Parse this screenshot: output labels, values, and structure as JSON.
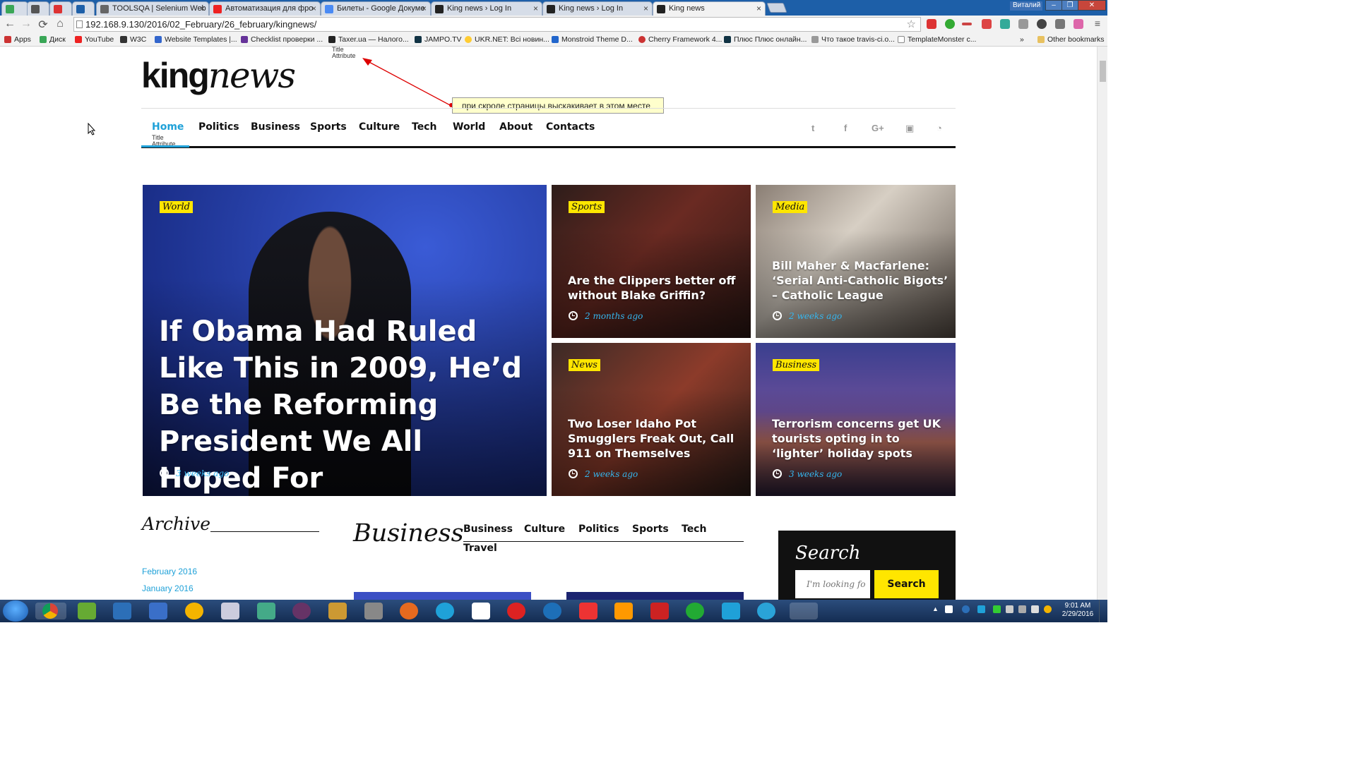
{
  "browser": {
    "tabs": [
      {
        "label": "",
        "active": false
      },
      {
        "label": "",
        "active": false
      },
      {
        "label": "",
        "active": false
      },
      {
        "label": "",
        "active": false
      },
      {
        "label": "TOOLSQA | Selenium Web",
        "active": false
      },
      {
        "label": "Автоматизация для фро",
        "active": false
      },
      {
        "label": "Билеты - Google Докуме",
        "active": false
      },
      {
        "label": "King news › Log In",
        "active": false
      },
      {
        "label": "King news › Log In",
        "active": false
      },
      {
        "label": "King news",
        "active": true
      }
    ],
    "user_name": "Виталий",
    "url": "192.168.9.130/2016/02_February/26_february/kingnews/",
    "bookmarks": [
      "Apps",
      "Диск",
      "YouTube",
      "W3C",
      "Website Templates |...",
      "Checklist проверки ...",
      "Taxer.ua — Налого...",
      "JAMPO.TV",
      "UKR.NET: Всі новин...",
      "Monstroid Theme D...",
      "Cherry Framework 4...",
      "Плюс Плюс онлайн...",
      "Что такое travis-ci.o...",
      "TemplateMonster c..."
    ],
    "other_bookmarks": "Other bookmarks",
    "badge_count": "2"
  },
  "site": {
    "logo_bold": "king",
    "logo_italic": "news",
    "tooltip_top": "Title Attribute",
    "annotation": "при скроле страницы выскакивает в этом месте",
    "nav": [
      "Home",
      "Politics",
      "Business",
      "Sports",
      "Culture",
      "Tech",
      "World",
      "About",
      "Contacts"
    ],
    "nav_tooltip": "Title Attribute",
    "social": [
      "twitter-icon",
      "facebook-icon",
      "google-plus-icon",
      "youtube-icon",
      "rss-icon"
    ]
  },
  "hero": {
    "main": {
      "tag": "World",
      "title": "If Obama Had Ruled Like This in 2009, He’d Be the Reforming President We All Hoped For",
      "time": "3 weeks ago"
    },
    "cards": [
      {
        "tag": "Sports",
        "title": "Are the Clippers better off without Blake Griffin?",
        "time": "2 months ago"
      },
      {
        "tag": "Media",
        "title": "Bill Maher & Macfarlene: ‘Serial Anti-Catholic Bigots’ – Catholic League",
        "time": "2 weeks ago"
      },
      {
        "tag": "News",
        "title": "Two Loser Idaho Pot Smugglers Freak Out, Call 911 on Themselves",
        "time": "2 weeks ago"
      },
      {
        "tag": "Business",
        "title": "Terrorism concerns get UK tourists opting in to ‘lighter’ holiday spots",
        "time": "3 weeks ago"
      }
    ]
  },
  "archive": {
    "title": "Archive",
    "links": [
      "February 2016",
      "January 2016"
    ]
  },
  "business": {
    "title": "Business",
    "tabs": [
      "Business",
      "Culture",
      "Politics",
      "Sports",
      "Tech",
      "Travel"
    ]
  },
  "search": {
    "title": "Search",
    "placeholder": "I'm looking fo",
    "button": "Search"
  },
  "taskbar": {
    "time": "9:01 AM",
    "date": "2/29/2016"
  },
  "colors": {
    "accent": "#1fa1d8",
    "tag_yellow": "#ffe600",
    "meta_blue": "#35b6ef"
  }
}
